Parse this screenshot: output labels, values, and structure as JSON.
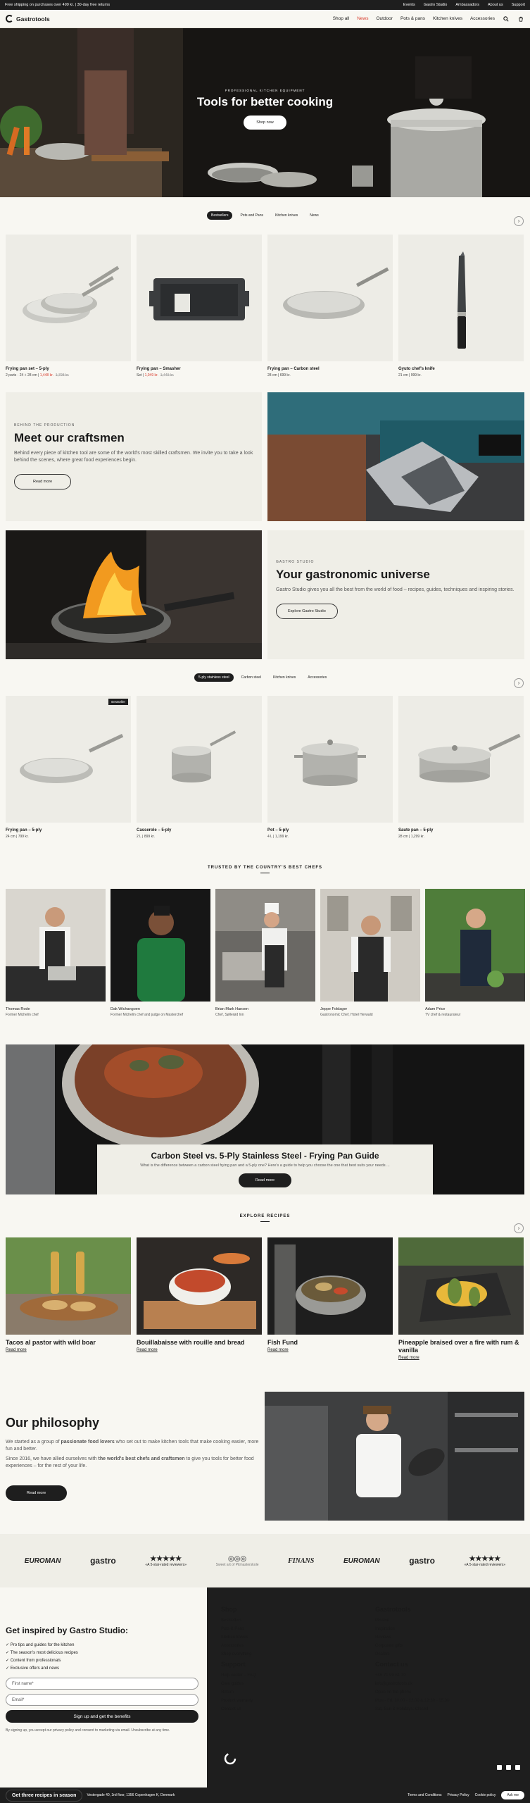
{
  "topbar": {
    "promo": "Free shipping on purchases over 499 kr. | 30-day free returns",
    "links": [
      "Events",
      "Gastro Studio",
      "Ambassadors",
      "About us",
      "Support"
    ]
  },
  "nav": {
    "brand": "Gastrotools",
    "links": [
      "Shop all",
      "News",
      "Outdoor",
      "Pots & pans",
      "Kitchen knives",
      "Accessories"
    ]
  },
  "hero": {
    "eyebrow": "PROFESSIONAL KITCHEN EQUIPMENT",
    "title": "Tools for better cooking",
    "button": "Shop now"
  },
  "tabs1": [
    "Bestsellers",
    "Pots and Pans",
    "Kitchen knives",
    "News"
  ],
  "products1": [
    {
      "name": "Frying pan set – 5-ply",
      "price_prefix": "2 parts · 24 + 28 cm |",
      "price_sale": "1,448 kr.",
      "price_old": "1,798 kr."
    },
    {
      "name": "Frying pan – Smasher",
      "price_prefix": "Set |",
      "price_sale": "1,049 kr.",
      "price_old": "1,449 kr."
    },
    {
      "name": "Frying pan – Carbon steel",
      "price_prefix": "28 cm | 699 kr.",
      "price_sale": "",
      "price_old": ""
    },
    {
      "name": "Gyuto chef's knife",
      "price_prefix": "21 cm | 999 kr.",
      "price_sale": "",
      "price_old": ""
    }
  ],
  "craftsmen": {
    "eyebrow": "BEHIND THE PRODUCTION",
    "title": "Meet our craftsmen",
    "body": "Behind every piece of kitchen tool are some of the world's most skilled craftsmen. We invite you to take a look behind the scenes, where great food experiences begin.",
    "button": "Read more"
  },
  "studio": {
    "eyebrow": "GASTRO STUDIO",
    "title": "Your gastronomic universe",
    "body": "Gastro Studio gives you all the best from the world of food – recipes, guides, techniques and inspiring stories.",
    "button": "Explore Gastro Studio"
  },
  "tabs2": [
    "5-ply stainless steel",
    "Carbon steel",
    "Kitchen knives",
    "Accessories"
  ],
  "products2": [
    {
      "name": "Frying pan – 5-ply",
      "price": "24 cm | 799 kr.",
      "badge": "Bestseller"
    },
    {
      "name": "Casserole – 5-ply",
      "price": "2 L | 899 kr.",
      "badge": ""
    },
    {
      "name": "Pot – 5-ply",
      "price": "4 L | 1,199 kr.",
      "badge": ""
    },
    {
      "name": "Saute pan – 5-ply",
      "price": "28 cm | 1,299 kr.",
      "badge": ""
    }
  ],
  "chefs_title": "TRUSTED BY THE COUNTRY'S BEST CHEFS",
  "chefs": [
    {
      "name": "Thomas Rode",
      "role": "Former Michelin chef"
    },
    {
      "name": "Dak Wichangoen",
      "role": "Former Michelin chef and judge on Masterchef"
    },
    {
      "name": "Brian Mark Hansen",
      "role": "Chef, Søllerød Inn"
    },
    {
      "name": "Jeppe Foldager",
      "role": "Gastronomic Chef, Hotel Herwald"
    },
    {
      "name": "Adam Price",
      "role": "TV chef & restaurateur"
    }
  ],
  "guide": {
    "title": "Carbon Steel vs. 5-Ply Stainless Steel - Frying Pan Guide",
    "body": "What is the difference between a carbon steel frying pan and a 5-ply one? Here's a guide to help you choose the one that best suits your needs ...",
    "button": "Read more"
  },
  "recipes_title": "EXPLORE RECIPES",
  "recipes": [
    {
      "title": "Tacos al pastor with wild boar",
      "link": "Read more"
    },
    {
      "title": "Bouillabaisse with rouille and bread",
      "link": "Read more"
    },
    {
      "title": "Fish Fund",
      "link": "Read more"
    },
    {
      "title": "Pineapple braised over a fire with rum & vanilla",
      "link": "Read more"
    }
  ],
  "philosophy": {
    "title": "Our philosophy",
    "p1a": "We started as a group of ",
    "p1b": "passionate food lovers",
    "p1c": " who set out to make kitchen tools that make cooking easier, more fun and better.",
    "p2a": "Since 2016, we have allied ourselves with ",
    "p2b": "the world's best chefs and craftsmen",
    "p2c": " to give you tools for better food experiences – for the rest of your life.",
    "button": "Read more"
  },
  "press": [
    {
      "name": "EUROMAN",
      "sub": ""
    },
    {
      "name": "gastro",
      "sub": ""
    },
    {
      "name": "★★★★★",
      "sub": "«A 5-star-rated reviewers»"
    },
    {
      "name": "◎◎◎",
      "sub": "Sweet art of Pitmasterskole"
    },
    {
      "name": "FINANS",
      "sub": ""
    },
    {
      "name": "EUROMAN",
      "sub": ""
    },
    {
      "name": "gastro",
      "sub": ""
    },
    {
      "name": "★★★★★",
      "sub": "«A 5-star-rated reviewers»"
    }
  ],
  "newsletter": {
    "title": "Get inspired by Gastro Studio:",
    "checks": [
      "✓ Pro tips and guides for the kitchen",
      "✓ The season's most delicious recipes",
      "✓ Content from professionals",
      "✓ Exclusive offers and news"
    ],
    "first_name": "First name*",
    "email": "Email*",
    "button": "Sign up and get the benefits",
    "legal": "By signing up, you accept our privacy policy and consent to marketing via email. Unsubscribe at any time."
  },
  "footer": {
    "shop_title": "Shop",
    "shop": [
      "Bestsellers",
      "Pots & Pans",
      "Kitchen knives",
      "Accessories",
      "Shop everything"
    ],
    "support_title": "Support",
    "support": [
      "Help center – FAQ",
      "Care guides",
      "Return",
      "Product warranty",
      "Contact us"
    ],
    "brand_title": "Gastrotools",
    "brand": [
      "Mission",
      "Inspiration",
      "Reviews",
      "Corporate gifts",
      "Dealers"
    ],
    "contact_title": "Contact us",
    "contact": [
      "+45 71 99 61 70",
      "info@gastrotools.dk",
      "Open on the phone:",
      "Mon - Fri: 10:00 - 12:00 & 12:30 - 15:30",
      "Sat, Sun & Holidays: Closed"
    ],
    "address": "Vestergade 40, 3rd floor, 1356 Copenhagen K, Denmark",
    "legal_links": [
      "Terms and Conditions",
      "Privacy Policy",
      "Cookie policy"
    ],
    "promo_pill": "Get three recipes in season",
    "chat": "Ask me"
  }
}
